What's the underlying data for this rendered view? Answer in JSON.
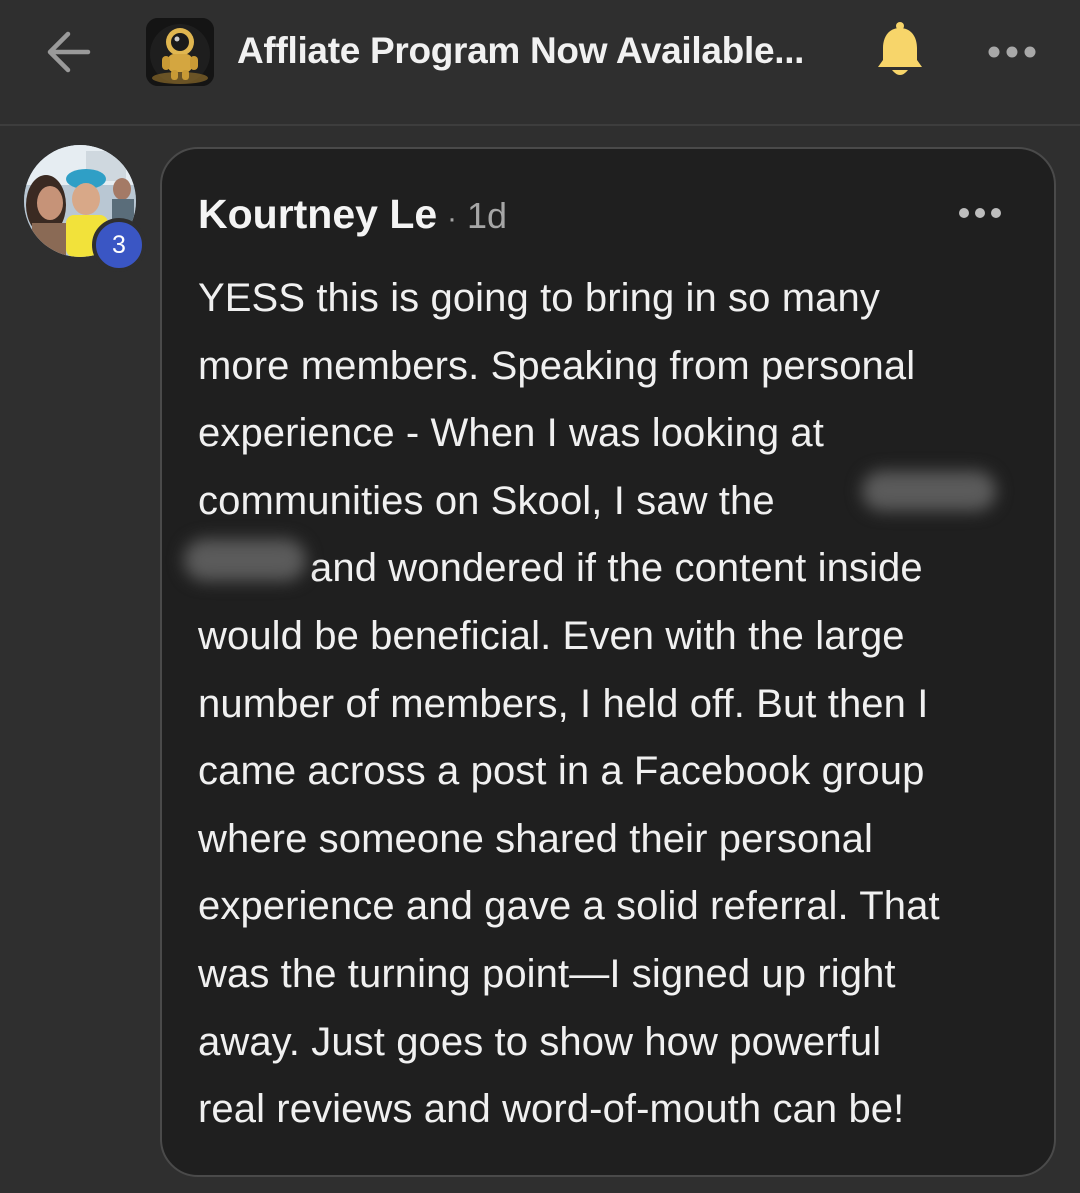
{
  "header": {
    "title": "Affliate Program Now Available...",
    "back_icon": "arrow-left-icon",
    "bell_icon": "bell-icon",
    "more_icon": "more-horizontal-icon"
  },
  "post": {
    "author": "Kourtney Le",
    "separator": "·",
    "time": "1d",
    "level": "3",
    "body_lines": [
      "YESS this is going to bring in so many",
      "more members. Speaking from personal",
      "experience - When I was looking at",
      "communities on Skool, I saw the",
      "and wondered if the content inside",
      "would be beneficial. Even with the large",
      "number of members, I held off. But then I",
      "came across a post in a Facebook group",
      "where someone shared their personal",
      "experience and gave a solid referral. That",
      "was the turning point—I signed up right",
      "away. Just goes to show how powerful",
      "real reviews and word-of-mouth can be!"
    ]
  },
  "colors": {
    "background": "#2f2f2f",
    "card": "#1f1f1f",
    "bell": "#f7d56a",
    "badge": "#3a56c4"
  }
}
